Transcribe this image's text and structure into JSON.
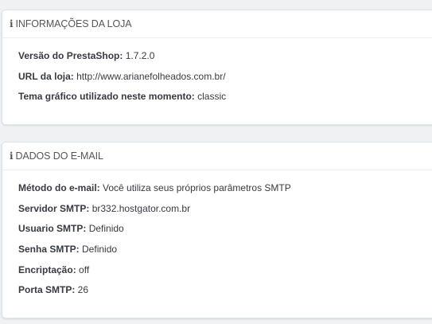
{
  "store_panel": {
    "title": "INFORMAÇÕES DA LOJA",
    "icon": "info-icon",
    "rows": [
      {
        "label": "Versão do PrestaShop:",
        "value": "1.7.2.0"
      },
      {
        "label": "URL da loja:",
        "value": "http://www.arianefolheados.com.br/"
      },
      {
        "label": "Tema gráfico utilizado neste momento:",
        "value": "classic"
      }
    ]
  },
  "email_panel": {
    "title": "DADOS DO E-MAIL",
    "icon": "info-icon",
    "rows": [
      {
        "label": "Método do e-mail:",
        "value": "Você utiliza seus próprios parâmetros SMTP"
      },
      {
        "label": "Servidor SMTP:",
        "value": "br332.hostgator.com.br"
      },
      {
        "label": "Usuario SMTP:",
        "value": "Definido"
      },
      {
        "label": "Senha SMTP:",
        "value": "Definido"
      },
      {
        "label": "Encriptação:",
        "value": "off"
      },
      {
        "label": "Porta SMTP:",
        "value": "26"
      }
    ]
  }
}
